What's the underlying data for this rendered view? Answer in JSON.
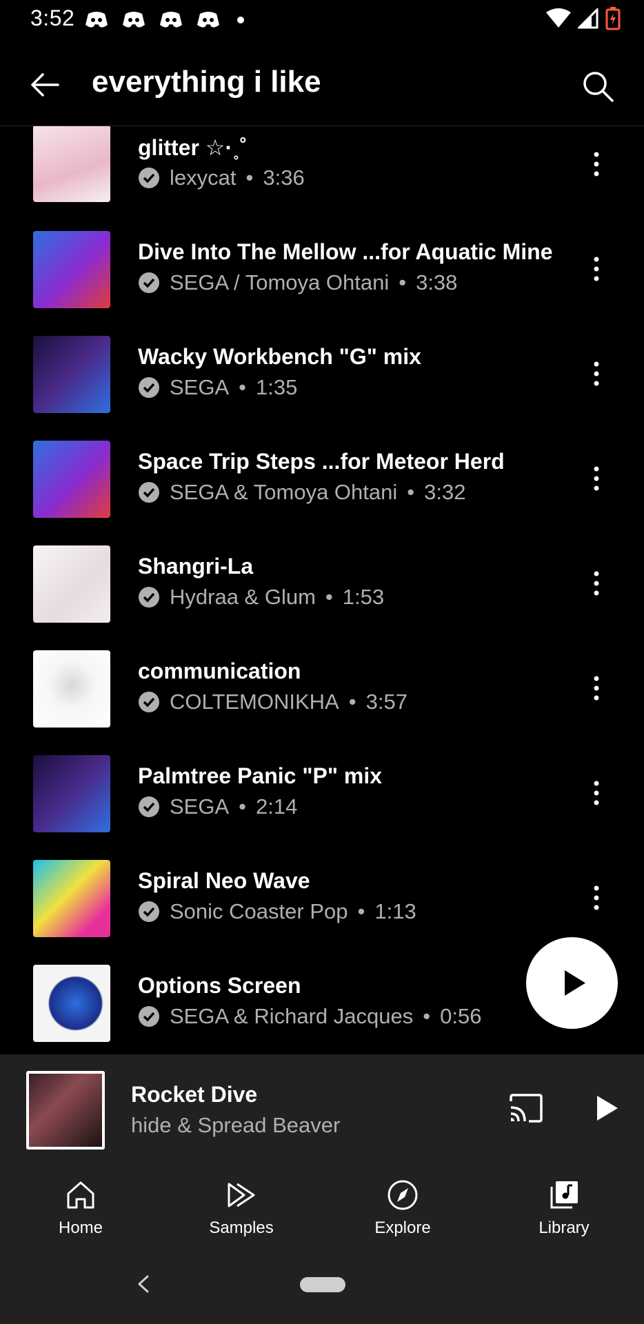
{
  "status_bar": {
    "time": "3:52"
  },
  "header": {
    "title": "everything i like"
  },
  "tracks": [
    {
      "title": "glitter ☆·˳˚",
      "artist": "lexycat",
      "duration": "3:36",
      "thumb_color": "#f3d6de"
    },
    {
      "title": "Dive Into The Mellow ...for Aquatic Mine",
      "artist": "SEGA / Tomoya Ohtani",
      "duration": "3:38",
      "thumb_color": "#2b5fd6"
    },
    {
      "title": "Wacky Workbench \"G\" mix",
      "artist": "SEGA",
      "duration": "1:35",
      "thumb_color": "#4a2a8a"
    },
    {
      "title": "Space Trip Steps ...for Meteor Herd",
      "artist": "SEGA & Tomoya Ohtani",
      "duration": "3:32",
      "thumb_color": "#2b5fd6"
    },
    {
      "title": "Shangri-La",
      "artist": "Hydraa & Glum",
      "duration": "1:53",
      "thumb_color": "#f2eef0"
    },
    {
      "title": "communication",
      "artist": "COLTEMONIKHA",
      "duration": "3:57",
      "thumb_color": "#f4f4f4"
    },
    {
      "title": "Palmtree Panic \"P\" mix",
      "artist": "SEGA",
      "duration": "2:14",
      "thumb_color": "#4a2a8a"
    },
    {
      "title": "Spiral Neo Wave",
      "artist": "Sonic Coaster Pop",
      "duration": "1:13",
      "thumb_color": "#1fb0e0"
    },
    {
      "title": "Options Screen",
      "artist": "SEGA & Richard Jacques",
      "duration": "0:56",
      "thumb_color": "#1a2f8a"
    }
  ],
  "now_playing": {
    "title": "Rocket Dive",
    "artist": "hide & Spread Beaver"
  },
  "bottom_nav": [
    {
      "label": "Home",
      "icon": "home-icon"
    },
    {
      "label": "Samples",
      "icon": "samples-icon"
    },
    {
      "label": "Explore",
      "icon": "explore-icon"
    },
    {
      "label": "Library",
      "icon": "library-icon"
    }
  ]
}
